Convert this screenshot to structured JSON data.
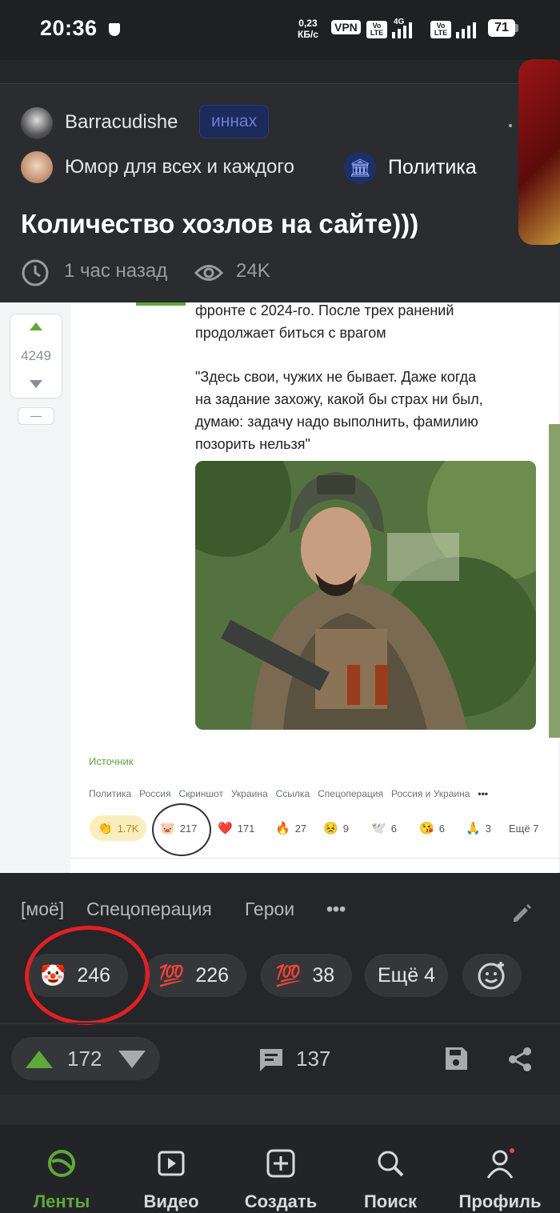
{
  "status_bar": {
    "time": "20:36",
    "speed_top": "0,23",
    "speed_bottom": "КБ/с",
    "vpn": "VPN",
    "lte1": "Vo LTE",
    "net1": "4G",
    "lte2": "Vo LTE",
    "battery": "71"
  },
  "post": {
    "author": "Barracudishe",
    "author_badge": "иннах",
    "community": "Юмор для всех и каждого",
    "category": "Политика",
    "category_icon": "building-icon",
    "title": "Количество хозлов на сайте)))",
    "time_ago": "1 час назад",
    "views": "24K"
  },
  "embedded_screenshot": {
    "rating": "4249",
    "minus": "—",
    "text_lines": [
      "фронте с 2024-го. После трех ранений",
      "продолжает биться с врагом",
      "",
      "\"Здесь свои, чужих не бывает. Даже когда",
      "на задание захожу, какой бы страх ни был,",
      "думаю: задачу надо выполнить, фамилию",
      "позорить нельзя\""
    ],
    "source_label": "Источник",
    "tags": [
      "Политика",
      "Россия",
      "Скриншот",
      "Украина",
      "Ссылка",
      "Спецоперация",
      "Россия и Украина",
      "•••"
    ],
    "reactions": [
      {
        "emoji": "👏",
        "count": "1.7K"
      },
      {
        "emoji": "🐷",
        "count": "217"
      },
      {
        "emoji": "❤️",
        "count": "171"
      },
      {
        "emoji": "🔥",
        "count": "27"
      },
      {
        "emoji": "😣",
        "count": "9"
      },
      {
        "emoji": "🕊️",
        "count": "6"
      },
      {
        "emoji": "😘",
        "count": "6"
      },
      {
        "emoji": "🙏",
        "count": "3"
      }
    ],
    "more": "Ещё 7"
  },
  "tags": [
    "[моё]",
    "Спецоперация",
    "Герои"
  ],
  "tags_more": "•••",
  "reactions": [
    {
      "emoji": "🤡",
      "count": "246"
    },
    {
      "emoji": "💯",
      "count": "226"
    },
    {
      "emoji": "💯",
      "count": "38"
    }
  ],
  "reactions_more": "Ещё 4",
  "votes": "172",
  "comments": "137",
  "bottom_nav": [
    {
      "label": "Ленты",
      "icon": "feed-icon"
    },
    {
      "label": "Видео",
      "icon": "video-icon"
    },
    {
      "label": "Создать",
      "icon": "plus-square-icon"
    },
    {
      "label": "Поиск",
      "icon": "search-icon"
    },
    {
      "label": "Профиль",
      "icon": "profile-icon"
    }
  ],
  "colors": {
    "accent": "#5fa83b",
    "annotation": "#e21f22"
  }
}
